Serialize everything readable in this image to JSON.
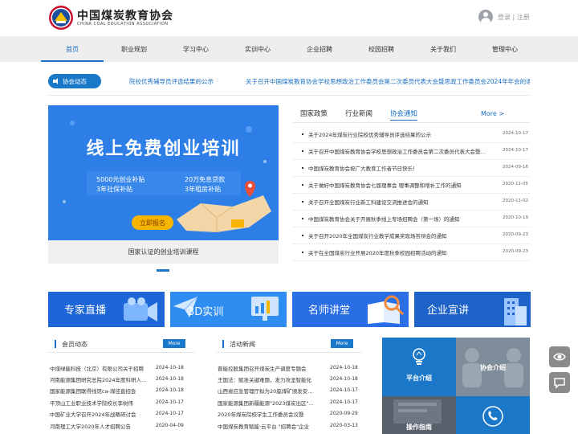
{
  "header": {
    "brand_cn": "中国煤炭教育协会",
    "brand_en": "CHINA COAL EDUCATION ASSOCIATION",
    "login": "登录",
    "separator": "|",
    "register": "注册"
  },
  "nav": {
    "items": [
      "首页",
      "职业规划",
      "学习中心",
      "实训中心",
      "企业招聘",
      "校园招聘",
      "关于我们",
      "管理中心"
    ],
    "active": "首页"
  },
  "notice": {
    "label": "协会动态",
    "items": [
      "院校优秀辅导员评选结果的公示",
      "关于召开中国煤炭教育协会学校思想政治工作委员会第二次委员代表大会暨思政工作委员会2024年年会的通"
    ]
  },
  "banner": {
    "headline": "线上免费创业培训",
    "benefit_1": "5000元创业补贴",
    "benefit_2": "3年社保补贴",
    "benefit_3": "20万免息贷款",
    "benefit_4": "3年租房补贴",
    "button": "立即报名",
    "caption": "国家认证的创业培训课程"
  },
  "news_tabs": {
    "tabs": [
      "国家政策",
      "行业新闻",
      "协会通知"
    ],
    "active": "协会通知",
    "more": "More >",
    "items": [
      {
        "title": "关于2024年煤炭行业院校优秀辅导员评选结果的公示",
        "date": "2024-10-17"
      },
      {
        "title": "关于召开中国煤炭教育协会学校思想政治工作委员会第二次委员代表大会暨思政工作委员会2024年年会的通知",
        "date": "2024-10-17"
      },
      {
        "title": "中国煤炭教育协会祝广大教育工作者节日快乐！",
        "date": "2024-09-16"
      },
      {
        "title": "关于做好中国煤炭教育协会七届理事会 理事调整和增补工作的通知",
        "date": "2020-11-05"
      },
      {
        "title": "关于召开全国煤炭行业新工科建设交流推进会的通知",
        "date": "2020-11-02"
      },
      {
        "title": "中国煤炭教育协会关于开展秋季线上专场招聘会（第一场）的通知",
        "date": "2020-10-19"
      },
      {
        "title": "关于召开2020年全国煤炭行业教学成果奖现场答辩会的通知",
        "date": "2020-09-23"
      },
      {
        "title": "关于在全国煤炭行业开展2020年度秋季校园招聘活动的通知",
        "date": "2020-09-23"
      }
    ]
  },
  "features": [
    {
      "label": "专家直播",
      "color": "#1e66d8",
      "icon": "video-camera-icon"
    },
    {
      "label": "3D实训",
      "color": "#2f8cf0",
      "icon": "paper-plane-icon"
    },
    {
      "label": "名师讲堂",
      "color": "#2a6ee6",
      "icon": "book-magnifier-icon"
    },
    {
      "label": "企业宣讲",
      "color": "#1f63c9",
      "icon": "building-icon"
    }
  ],
  "member_news": {
    "title": "会员动态",
    "more": "More",
    "items": [
      {
        "title": "中煤绿能科技（北京）有限公司关于招聘",
        "date": "2024-10-18"
      },
      {
        "title": "河南能源集团研究总院2024年度科研人才招聘",
        "date": "2024-10-18"
      },
      {
        "title": "国家能源集团联得线馆ca-煤径直招会",
        "date": "2024-10-18"
      },
      {
        "title": "平顶山工业职业技术学院校长李树伟",
        "date": "2024-10-17"
      },
      {
        "title": "中国矿业大学召开2024年战略研讨会",
        "date": "2024-10-17"
      },
      {
        "title": "河南理工大学2020年人才招聘公告",
        "date": "2020-04-09"
      }
    ]
  },
  "activity_news": {
    "title": "活动新闻",
    "more": "More",
    "items": [
      {
        "title": "晋能控股集团召开煤炭生产调度专题会",
        "date": "2024-10-18"
      },
      {
        "title": "王国法：赋准关键难题，发力攻坚智能化",
        "date": "2024-10-18"
      },
      {
        "title": "山西省应急管理厅拟为20座煤矿颁发安全生产",
        "date": "2024-10-17"
      },
      {
        "title": "国家能源集团新疆能源\"2023煤炭出区\"销量创新高",
        "date": "2024-10-17"
      },
      {
        "title": "2020年煤炭院校学生工作委员会议暨",
        "date": "2020-09-29"
      },
      {
        "title": "中国煤炭教育赋能·云平台 \"招聘会\"企业",
        "date": "2020-03-13"
      }
    ]
  },
  "quick_grid": [
    {
      "label": "平台介绍",
      "color": "#1b78c8",
      "icon": "lightbulb-icon"
    },
    {
      "label": "协会介绍",
      "color": "#7f8c99",
      "icon": "people-icon"
    },
    {
      "label": "操作指南",
      "color": "#56606b",
      "icon": "book-icon"
    },
    {
      "label": "",
      "color": "#1b78c8",
      "icon": "phone-icon"
    }
  ]
}
